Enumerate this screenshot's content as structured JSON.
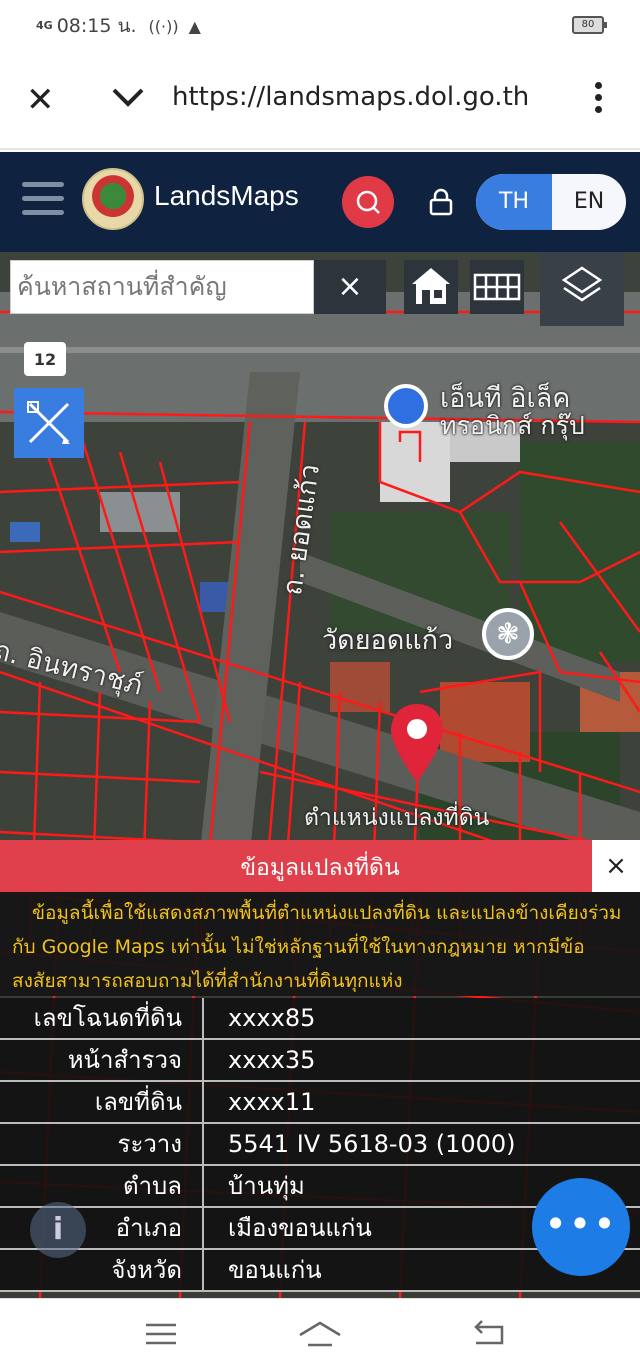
{
  "status_bar": {
    "network": "4G",
    "time": "08:15 น.",
    "battery": "80"
  },
  "browser": {
    "url": "https://landsmaps.dol.go.th",
    "icons": [
      "close-icon",
      "chevron-down-icon",
      "more-vert-icon"
    ]
  },
  "header": {
    "brand": "LandsMaps",
    "lang_th": "TH",
    "lang_en": "EN",
    "accent": "#3a7de0",
    "header_bg": "#0f2240",
    "search_color": "#e03a46"
  },
  "map": {
    "search_placeholder": "ค้นหาสถานที่สำคัญ",
    "clear_label": "×",
    "road_sign": "12",
    "labels": {
      "company": "เอ็นที อิเล็ค",
      "company2": "ทรอนิกส์ กรุ๊ป",
      "road_yodkaew": "ถ. ยอดแก้ว",
      "temple": "วัดยอดแก้ว",
      "road_innarat": "ถ. อินทราชุภ์",
      "parcel_position": "ตำแหน่งแปลงที่ดิน"
    },
    "parcel_line_color": "#ff1a1a"
  },
  "panel": {
    "title": "ข้อมูลแปลงที่ดิน",
    "close_label": "×",
    "disclaimer": "ข้อมูลนี้เพื่อใช้แสดงสภาพพื้นที่ตำแหน่งแปลงที่ดิน และแปลงข้างเคียงร่วมกับ Google Maps เท่านั้น ไม่ใช่หลักฐานที่ใช้ในทางกฎหมาย หากมีข้อสงสัยสามารถสอบถามได้ที่สำนักงานที่ดินทุกแห่ง",
    "rows": [
      {
        "label": "เลขโฉนดที่ดิน",
        "value": "xxxx85"
      },
      {
        "label": "หน้าสำรวจ",
        "value": "xxxx35"
      },
      {
        "label": "เลขที่ดิน",
        "value": "xxxx11"
      },
      {
        "label": "ระวาง",
        "value": "5541 IV 5618-03 (1000)"
      },
      {
        "label": "ตำบล",
        "value": "บ้านทุ่ม"
      },
      {
        "label": "อำเภอ",
        "value": "เมืองขอนแก่น"
      },
      {
        "label": "จังหวัด",
        "value": "ขอนแก่น"
      }
    ],
    "info_label": "i",
    "fab_label": "•••"
  }
}
